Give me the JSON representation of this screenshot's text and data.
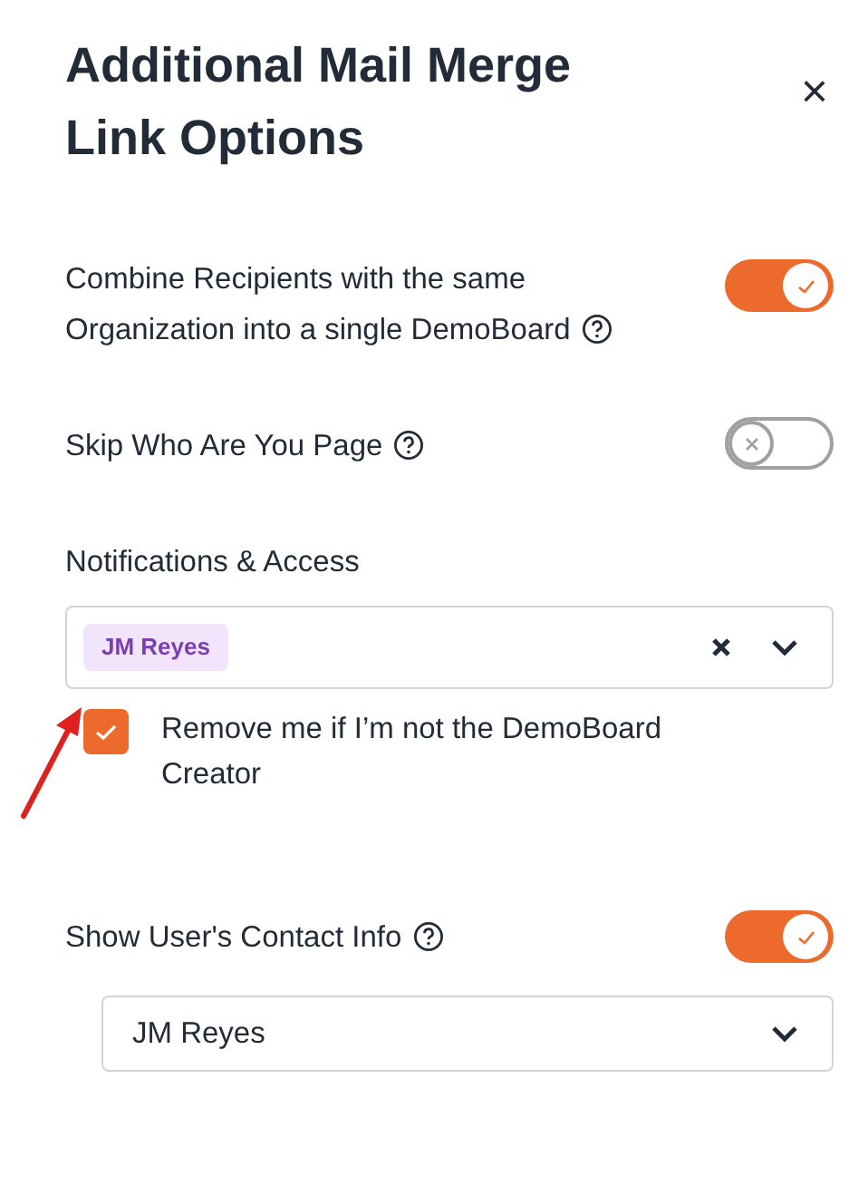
{
  "title": "Additional Mail Merge Link Options",
  "close": "×",
  "options": [
    {
      "label": "Combine Recipients with the same Organization into a single DemoBoard",
      "on": true
    },
    {
      "label": "Skip Who Are You Page",
      "on": false
    }
  ],
  "notifications": {
    "label": "Notifications & Access",
    "chips": [
      "JM Reyes"
    ],
    "checkbox": {
      "label": "Remove me if I’m not the DemoBoard Creator",
      "checked": true
    }
  },
  "contact": {
    "label": "Show User's Contact Info",
    "on": true,
    "select_value": "JM Reyes"
  }
}
